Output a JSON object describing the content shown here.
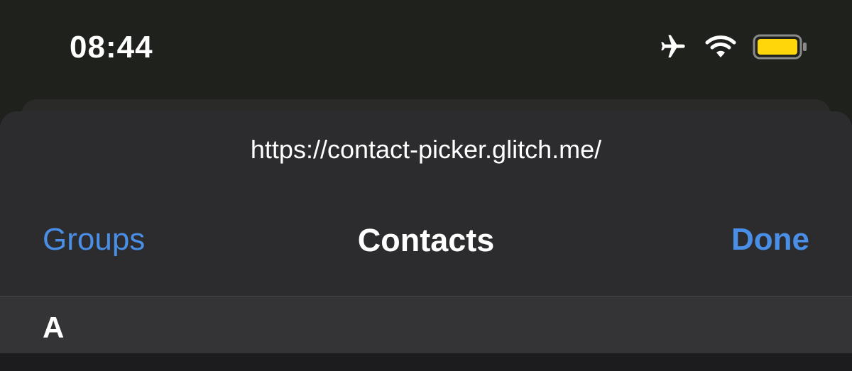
{
  "status_bar": {
    "time": "08:44",
    "icons": [
      "airplane-icon",
      "wifi-icon",
      "battery-icon"
    ],
    "battery_color": "#ffd60a"
  },
  "sheet": {
    "url": "https://contact-picker.glitch.me/",
    "nav": {
      "left_label": "Groups",
      "title": "Contacts",
      "right_label": "Done"
    },
    "sections": [
      {
        "letter": "A"
      }
    ]
  },
  "colors": {
    "accent": "#4a8fe7",
    "sheet_bg": "#2c2c2e",
    "section_bg": "#343436",
    "background": "#1f211d"
  }
}
